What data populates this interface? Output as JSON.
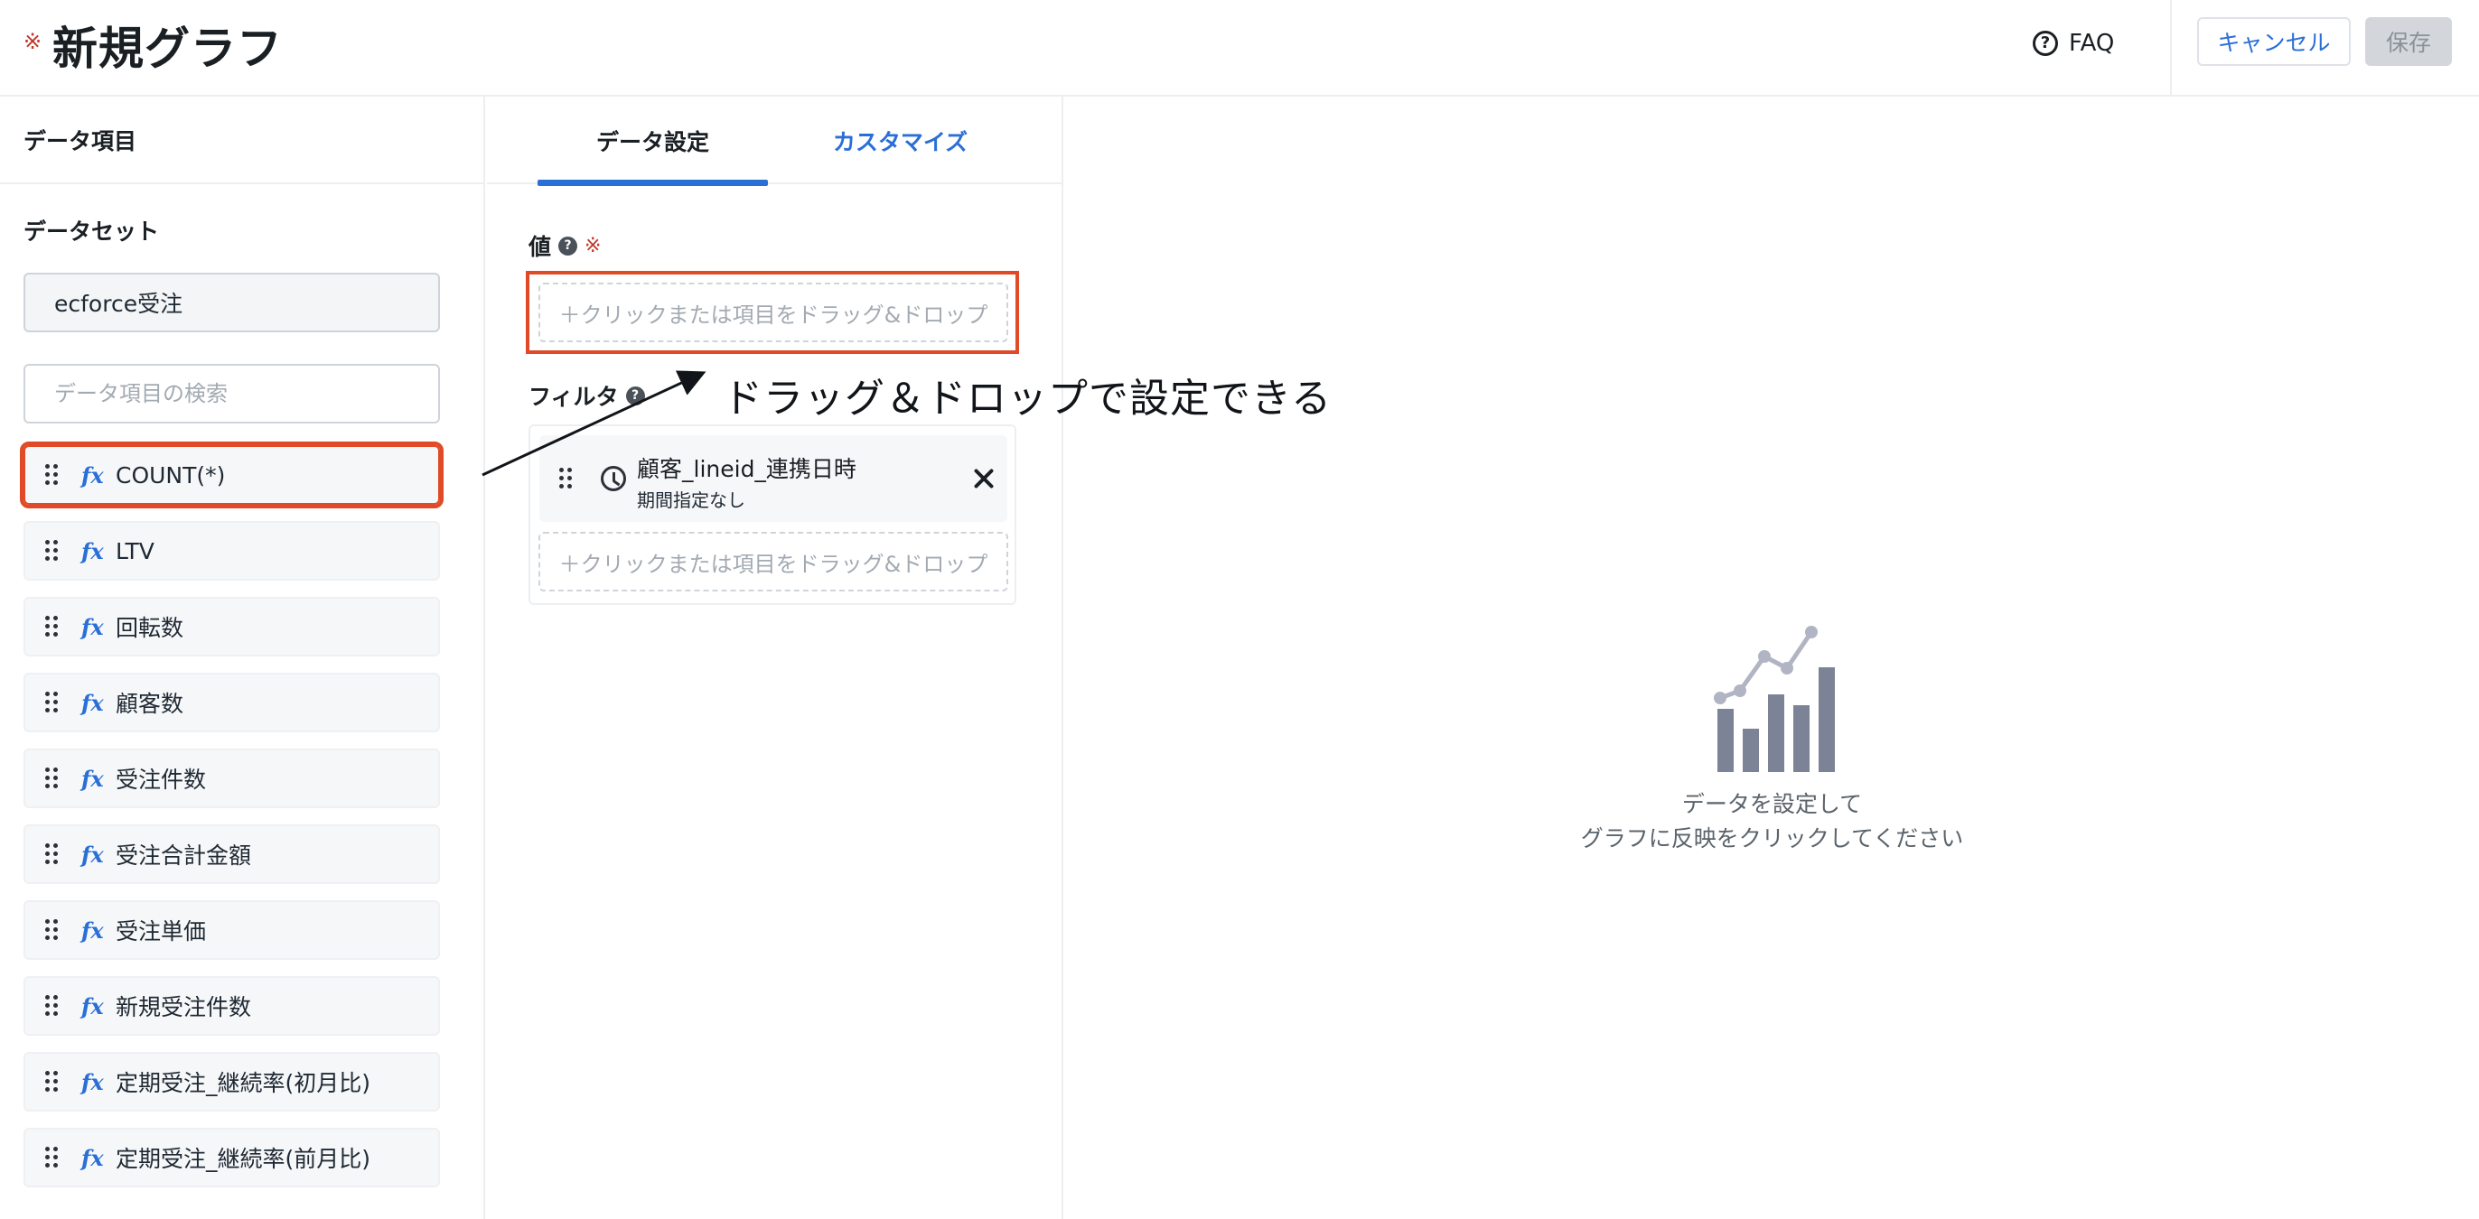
{
  "header": {
    "required_mark": "※",
    "title": "新規グラフ",
    "faq_label": "FAQ",
    "cancel_label": "キャンセル",
    "save_label": "保存"
  },
  "left_panel": {
    "heading": "データ項目",
    "dataset_label": "データセット",
    "dataset_value": "ecforce受注",
    "search_placeholder": "データ項目の検索",
    "fields": [
      {
        "icon": "fx-icon",
        "label": "COUNT(*)"
      },
      {
        "icon": "fx-icon",
        "label": "LTV"
      },
      {
        "icon": "fx-icon",
        "label": "回転数"
      },
      {
        "icon": "fx-icon",
        "label": "顧客数"
      },
      {
        "icon": "fx-icon",
        "label": "受注件数"
      },
      {
        "icon": "fx-icon",
        "label": "受注合計金額"
      },
      {
        "icon": "fx-icon",
        "label": "受注単価"
      },
      {
        "icon": "fx-icon",
        "label": "新規受注件数"
      },
      {
        "icon": "fx-icon",
        "label": "定期受注_継続率(初月比)"
      },
      {
        "icon": "fx-icon",
        "label": "定期受注_継続率(前月比)"
      }
    ]
  },
  "middle_panel": {
    "tabs": [
      {
        "label": "データ設定",
        "active": true
      },
      {
        "label": "カスタマイズ",
        "active": false
      }
    ],
    "value_label": "値",
    "required_mark": "※",
    "drop_placeholder": "＋クリックまたは項目をドラッグ&ドロップ",
    "filter_label": "フィルタ",
    "filters": [
      {
        "name": "顧客_lineid_連携日時",
        "sub": "期間指定なし"
      }
    ]
  },
  "annotation": {
    "text": "ドラッグ＆ドロップで設定できる"
  },
  "preview": {
    "message_line1": "データを設定して",
    "message_line2": "グラフに反映をクリックしてください"
  },
  "colors": {
    "accent": "#2a6fd6",
    "highlight": "#e04a26",
    "required": "#c0392b",
    "chart_icon": "#7d8396"
  }
}
